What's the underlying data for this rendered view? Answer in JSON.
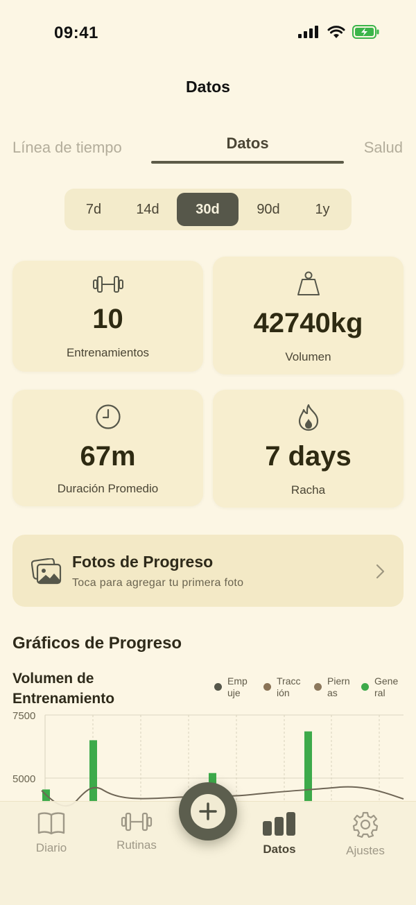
{
  "status": {
    "time": "09:41"
  },
  "title": "Datos",
  "tabs": [
    "Línea de tiempo",
    "Datos",
    "Salud"
  ],
  "ranges": [
    "7d",
    "14d",
    "30d",
    "90d",
    "1y"
  ],
  "selected_range": "30d",
  "stats": {
    "workouts": {
      "value": "10",
      "label": "Entrenamientos",
      "icon": "dumbbell-icon"
    },
    "volume": {
      "value": "42740kg",
      "label": "Volumen",
      "icon": "weight-icon"
    },
    "duration": {
      "value": "67m",
      "label": "Duración Promedio",
      "icon": "clock-icon"
    },
    "streak": {
      "value": "7 days",
      "label": "Racha",
      "icon": "flame-icon"
    }
  },
  "photos": {
    "title": "Fotos de Progreso",
    "subtitle": "Toca para agregar tu primera foto"
  },
  "section_title": "Gráficos de Progreso",
  "chart": {
    "title": "Volumen de Entrenamiento",
    "legend": [
      {
        "name": "Empuje",
        "color": "#56574A"
      },
      {
        "name": "Tracción",
        "color": "#8A7356"
      },
      {
        "name": "Piernas",
        "color": "#8C785C"
      },
      {
        "name": "General",
        "color": "#3DAA4A"
      }
    ]
  },
  "chart_data": {
    "type": "bar",
    "title": "Volumen de Entrenamiento",
    "y_ticks": [
      7500,
      5000
    ],
    "ylim_visible": [
      4500,
      8000
    ],
    "series": [
      {
        "name": "General",
        "values": [
          4550,
          6500,
          5200,
          6850
        ]
      }
    ],
    "trend_line": "present"
  },
  "tabbar": {
    "items": [
      {
        "label": "Diario",
        "icon": "book-icon"
      },
      {
        "label": "Rutinas",
        "icon": "dumbbell-icon"
      },
      {
        "label": "Datos",
        "icon": "bar-chart-icon"
      },
      {
        "label": "Ajustes",
        "icon": "gear-icon"
      }
    ],
    "fab_icon": "plus-icon"
  }
}
